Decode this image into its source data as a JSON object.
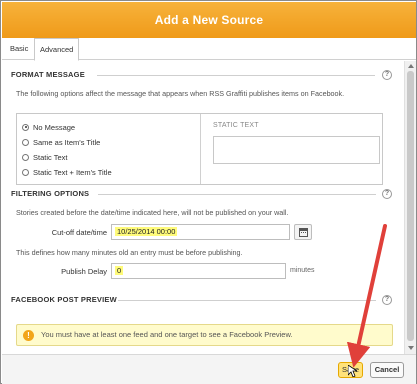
{
  "dialog": {
    "title": "Add a New Source"
  },
  "tabs": [
    {
      "label": "Basic",
      "active": false
    },
    {
      "label": "Advanced",
      "active": true
    }
  ],
  "format_message": {
    "header": "FORMAT MESSAGE",
    "help": "?",
    "description": "The following options affect the message that appears when RSS Graffiti publishes items on Facebook.",
    "options": [
      {
        "label": "No Message",
        "selected": true
      },
      {
        "label": "Same as Item's Title",
        "selected": false
      },
      {
        "label": "Static Text",
        "selected": false
      },
      {
        "label": "Static Text + Item's Title",
        "selected": false
      }
    ],
    "static_text_label": "STATIC TEXT",
    "static_text_value": ""
  },
  "filtering": {
    "header": "FILTERING OPTIONS",
    "help": "?",
    "cutoff_description": "Stories created before the date/time indicated here, will not be published on your wall.",
    "cutoff_label": "Cut-off date/time",
    "cutoff_value": "10/25/2014 00:00",
    "delay_description": "This defines how many minutes old an entry must be before publishing.",
    "delay_label": "Publish Delay",
    "delay_value": "0",
    "delay_unit": "minutes"
  },
  "preview": {
    "header": "FACEBOOK POST PREVIEW",
    "help": "?",
    "warning_icon": "!",
    "warning": "You must have at least one feed and one target to see a Facebook Preview."
  },
  "footer": {
    "save_label": "Save",
    "cancel_label": "Cancel"
  },
  "colors": {
    "title_bar": "#f5a623",
    "highlight": "#fffb7a",
    "arrow": "#e0403a",
    "warning_bg": "#fffbcc"
  },
  "icons": {
    "calendar": "calendar-icon",
    "help": "help-icon",
    "warning": "warning-icon",
    "cursor": "mouse-cursor-icon"
  }
}
